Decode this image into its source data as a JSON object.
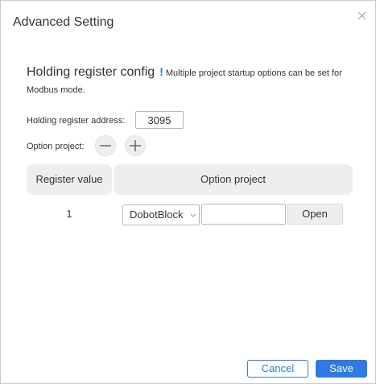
{
  "dialog": {
    "title": "Advanced Setting",
    "close_icon": "close-icon"
  },
  "section": {
    "title": "Holding register config",
    "info_icon": "!",
    "note": "Multiple project startup options can be set for Modbus mode."
  },
  "form": {
    "address_label": "Holding register address:",
    "address_value": "3095",
    "option_label": "Option project:",
    "remove_icon": "minus-icon",
    "add_icon": "plus-icon"
  },
  "table": {
    "headers": [
      "Register value",
      "Option project"
    ],
    "rows": [
      {
        "value": "1",
        "project": "DobotBlock",
        "path": "",
        "open_label": "Open"
      }
    ]
  },
  "footer": {
    "cancel_label": "Cancel",
    "save_label": "Save"
  },
  "colors": {
    "accent": "#2e7be3",
    "header_bg": "#eeeeee",
    "border": "#b9b9b9"
  }
}
